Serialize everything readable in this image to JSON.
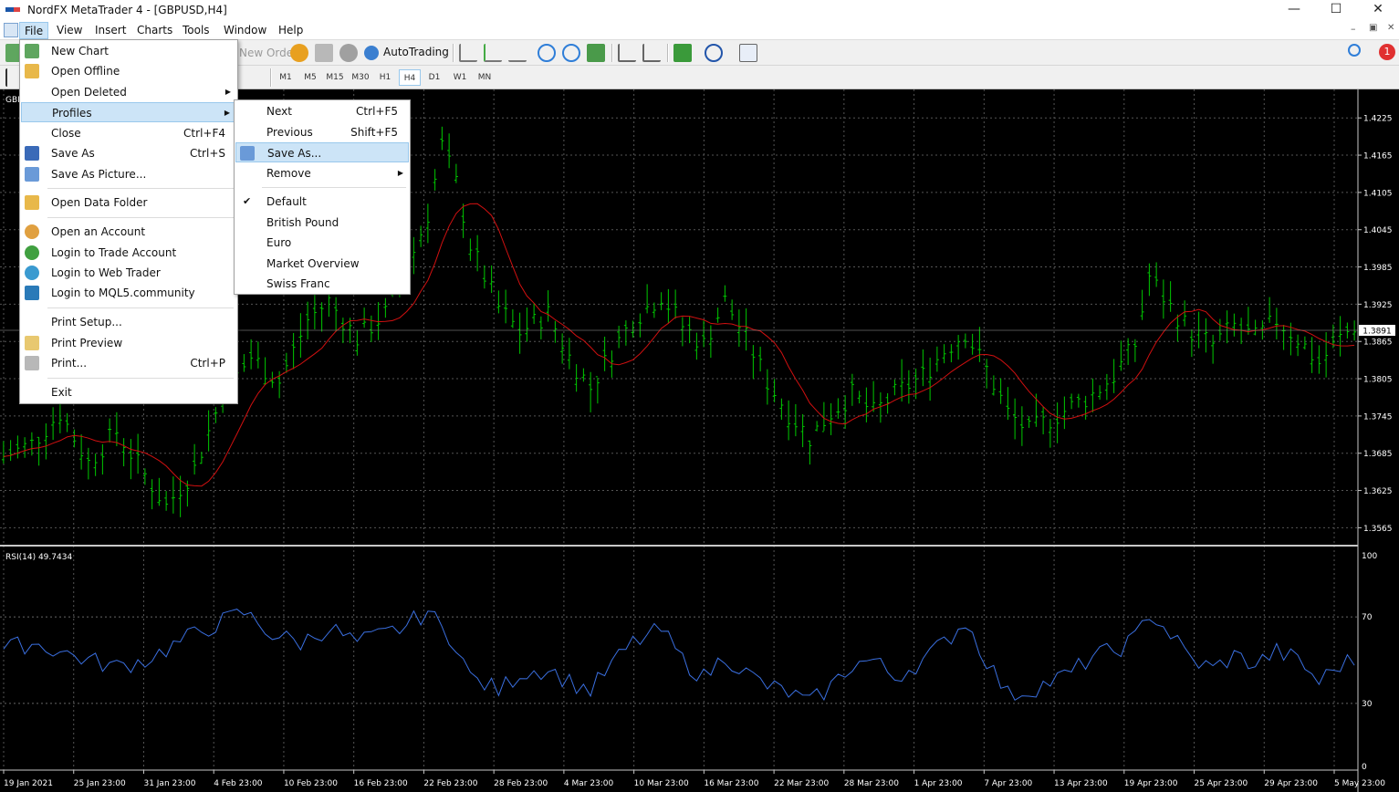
{
  "window": {
    "title": "NordFX MetaTrader 4 - [GBPUSD,H4]"
  },
  "menubar": {
    "items": [
      "File",
      "View",
      "Insert",
      "Charts",
      "Tools",
      "Window",
      "Help"
    ]
  },
  "toolbar": {
    "new_order": "New Order",
    "autotrading": "AutoTrading",
    "alert_count": "1"
  },
  "timeframes": [
    "M1",
    "M5",
    "M15",
    "M30",
    "H1",
    "H4",
    "D1",
    "W1",
    "MN"
  ],
  "selected_timeframe": "H4",
  "chart_label": "GBPUSD,H4",
  "file_menu": {
    "items": [
      {
        "label": "New Chart",
        "shortcut": "",
        "icon": "new-chart-icon"
      },
      {
        "label": "Open Offline",
        "shortcut": "",
        "icon": "folder-icon"
      },
      {
        "label": "Open Deleted",
        "shortcut": "",
        "arrow": true
      },
      {
        "label": "Profiles",
        "shortcut": "",
        "arrow": true,
        "highlighted": true
      },
      {
        "label": "Close",
        "shortcut": "Ctrl+F4"
      },
      {
        "label": "Save As",
        "shortcut": "Ctrl+S",
        "icon": "save-icon"
      },
      {
        "label": "Save As Picture...",
        "shortcut": "",
        "icon": "picture-icon"
      },
      {
        "label": "Open Data Folder",
        "shortcut": "",
        "icon": "folder-icon"
      },
      {
        "label": "Open an Account",
        "shortcut": "",
        "icon": "account-icon"
      },
      {
        "label": "Login to Trade Account",
        "shortcut": "",
        "icon": "login-icon"
      },
      {
        "label": "Login to Web Trader",
        "shortcut": "",
        "icon": "web-icon"
      },
      {
        "label": "Login to MQL5.community",
        "shortcut": "",
        "icon": "mql5-icon"
      },
      {
        "label": "Print Setup...",
        "shortcut": ""
      },
      {
        "label": "Print Preview",
        "shortcut": "",
        "icon": "print-preview-icon"
      },
      {
        "label": "Print...",
        "shortcut": "Ctrl+P",
        "icon": "printer-icon"
      },
      {
        "label": "Exit",
        "shortcut": ""
      }
    ]
  },
  "profiles_menu": {
    "items": [
      {
        "label": "Next",
        "shortcut": "Ctrl+F5"
      },
      {
        "label": "Previous",
        "shortcut": "Shift+F5"
      },
      {
        "label": "Save As...",
        "shortcut": "",
        "highlighted": true,
        "icon": "save-profile-icon"
      },
      {
        "label": "Remove",
        "shortcut": "",
        "arrow": true
      },
      {
        "label": "Default",
        "shortcut": "",
        "checked": true
      },
      {
        "label": "British Pound",
        "shortcut": ""
      },
      {
        "label": "Euro",
        "shortcut": ""
      },
      {
        "label": "Market Overview",
        "shortcut": ""
      },
      {
        "label": "Swiss Franc",
        "shortcut": ""
      }
    ]
  },
  "chart_data": {
    "type": "line",
    "symbol": "GBPUSD",
    "timeframe": "H4",
    "price_axis": {
      "ticks": [
        "1.4225",
        "1.4165",
        "1.4105",
        "1.4045",
        "1.3985",
        "1.3925",
        "1.3865",
        "1.3805",
        "1.3745",
        "1.3685",
        "1.3625",
        "1.3565"
      ],
      "range": [
        1.3545,
        1.4265
      ],
      "current": "1.3891"
    },
    "x_ticks": [
      "19 Jan 2021",
      "25 Jan 23:00",
      "31 Jan 23:00",
      "4 Feb 23:00",
      "10 Feb 23:00",
      "16 Feb 23:00",
      "22 Feb 23:00",
      "28 Feb 23:00",
      "4 Mar 23:00",
      "10 Mar 23:00",
      "16 Mar 23:00",
      "22 Mar 23:00",
      "28 Mar 23:00",
      "1 Apr 23:00",
      "7 Apr 23:00",
      "13 Apr 23:00",
      "19 Apr 23:00",
      "25 Apr 23:00",
      "29 Apr 23:00",
      "5 May 23:00"
    ],
    "price_colors": {
      "bars": "#00c800",
      "ma": "#d01010"
    },
    "price_keypoints": [
      [
        0,
        1.368
      ],
      [
        4,
        1.37
      ],
      [
        8,
        1.375
      ],
      [
        12,
        1.367
      ],
      [
        16,
        1.372
      ],
      [
        20,
        1.365
      ],
      [
        23,
        1.36
      ],
      [
        27,
        1.366
      ],
      [
        31,
        1.378
      ],
      [
        35,
        1.384
      ],
      [
        39,
        1.38
      ],
      [
        43,
        1.39
      ],
      [
        46,
        1.393
      ],
      [
        50,
        1.387
      ],
      [
        54,
        1.391
      ],
      [
        57,
        1.398
      ],
      [
        60,
        1.407
      ],
      [
        62,
        1.418
      ],
      [
        64,
        1.412
      ],
      [
        66,
        1.402
      ],
      [
        70,
        1.392
      ],
      [
        73,
        1.388
      ],
      [
        77,
        1.391
      ],
      [
        80,
        1.384
      ],
      [
        83,
        1.379
      ],
      [
        86,
        1.385
      ],
      [
        89,
        1.39
      ],
      [
        93,
        1.394
      ],
      [
        96,
        1.389
      ],
      [
        99,
        1.386
      ],
      [
        102,
        1.393
      ],
      [
        105,
        1.387
      ],
      [
        108,
        1.38
      ],
      [
        111,
        1.375
      ],
      [
        114,
        1.371
      ],
      [
        117,
        1.375
      ],
      [
        120,
        1.378
      ],
      [
        123,
        1.375
      ],
      [
        126,
        1.378
      ],
      [
        130,
        1.381
      ],
      [
        133,
        1.385
      ],
      [
        136,
        1.388
      ],
      [
        139,
        1.382
      ],
      [
        142,
        1.375
      ],
      [
        145,
        1.372
      ],
      [
        148,
        1.374
      ],
      [
        151,
        1.376
      ],
      [
        154,
        1.378
      ],
      [
        157,
        1.381
      ],
      [
        160,
        1.386
      ],
      [
        162,
        1.397
      ],
      [
        165,
        1.392
      ],
      [
        168,
        1.388
      ],
      [
        171,
        1.386
      ],
      [
        174,
        1.389
      ],
      [
        177,
        1.387
      ],
      [
        180,
        1.39
      ],
      [
        183,
        1.387
      ],
      [
        186,
        1.383
      ],
      [
        189,
        1.387
      ],
      [
        191,
        1.389
      ]
    ],
    "rsi": {
      "label": "RSI(14) 49.7434",
      "levels": [
        "100",
        "70",
        "30",
        "0"
      ],
      "range": [
        0,
        100
      ],
      "color": "#3a6fe0",
      "keypoints": [
        [
          0,
          55
        ],
        [
          4,
          58
        ],
        [
          8,
          54
        ],
        [
          12,
          50
        ],
        [
          16,
          47
        ],
        [
          20,
          50
        ],
        [
          23,
          55
        ],
        [
          27,
          62
        ],
        [
          31,
          68
        ],
        [
          34,
          72
        ],
        [
          38,
          62
        ],
        [
          42,
          58
        ],
        [
          46,
          65
        ],
        [
          50,
          58
        ],
        [
          54,
          62
        ],
        [
          57,
          66
        ],
        [
          60,
          73
        ],
        [
          62,
          64
        ],
        [
          64,
          58
        ],
        [
          66,
          42
        ],
        [
          70,
          36
        ],
        [
          73,
          44
        ],
        [
          77,
          46
        ],
        [
          80,
          40
        ],
        [
          83,
          36
        ],
        [
          86,
          48
        ],
        [
          89,
          58
        ],
        [
          93,
          64
        ],
        [
          96,
          50
        ],
        [
          99,
          42
        ],
        [
          102,
          52
        ],
        [
          105,
          44
        ],
        [
          108,
          38
        ],
        [
          111,
          35
        ],
        [
          114,
          30
        ],
        [
          117,
          38
        ],
        [
          120,
          48
        ],
        [
          123,
          50
        ],
        [
          126,
          42
        ],
        [
          130,
          50
        ],
        [
          133,
          58
        ],
        [
          136,
          68
        ],
        [
          139,
          50
        ],
        [
          142,
          34
        ],
        [
          145,
          36
        ],
        [
          148,
          40
        ],
        [
          151,
          44
        ],
        [
          154,
          52
        ],
        [
          157,
          54
        ],
        [
          160,
          60
        ],
        [
          162,
          72
        ],
        [
          165,
          62
        ],
        [
          168,
          50
        ],
        [
          171,
          46
        ],
        [
          174,
          52
        ],
        [
          177,
          48
        ],
        [
          180,
          54
        ],
        [
          183,
          50
        ],
        [
          186,
          40
        ],
        [
          189,
          48
        ],
        [
          191,
          50
        ]
      ]
    }
  }
}
